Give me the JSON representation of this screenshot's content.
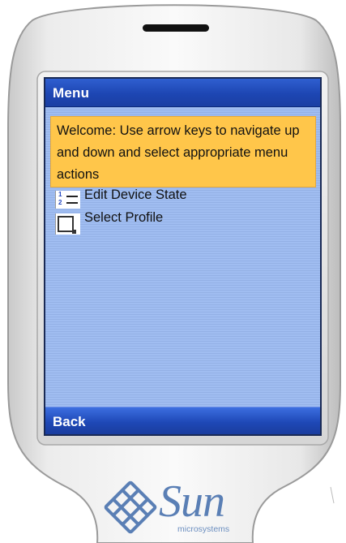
{
  "screen": {
    "title": "Menu",
    "welcome_message": "Welcome: Use arrow keys to navigate up and down and select appropriate menu actions",
    "menu_items": [
      {
        "label": "Edit Device State",
        "icon": "numbered-list-icon"
      },
      {
        "label": "Select Profile",
        "icon": "profile-page-icon"
      }
    ],
    "soft_key_left": "Back"
  },
  "branding": {
    "logo_word": "Sun",
    "logo_sub": "microsystems",
    "logo_color": "#5a7fb5"
  },
  "colors": {
    "title_bar": "#1d46b3",
    "screen_bg": "#9cb9ee",
    "welcome_bg": "#ffc64a"
  }
}
